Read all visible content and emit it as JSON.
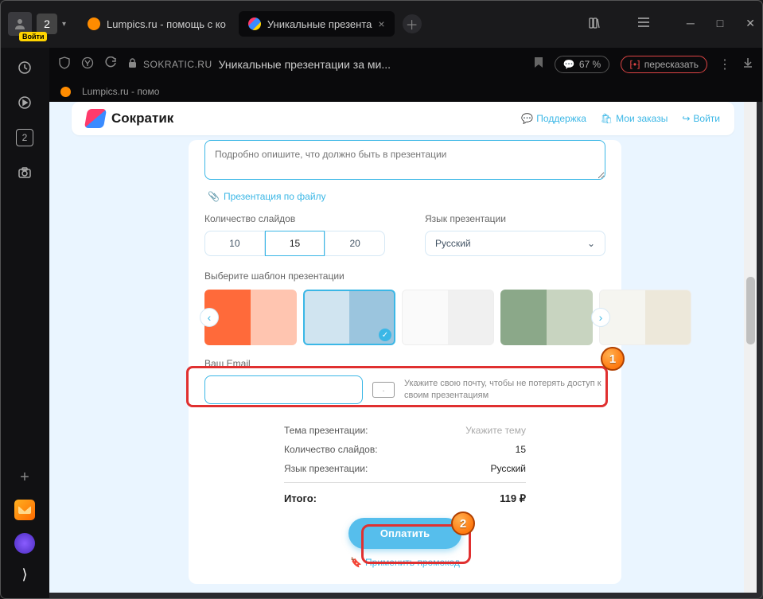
{
  "browser": {
    "login_badge": "Войти",
    "tab_count": "2",
    "tabs": [
      {
        "label": "Lumpics.ru - помощь с ко"
      },
      {
        "label": "Уникальные презента"
      }
    ],
    "domain": "sokratic.ru",
    "page_title": "Уникальные презентации за ми...",
    "zoom": "67 %",
    "summarize": "пересказать",
    "bookmark_label": "Lumpics.ru - помо",
    "sidebar_count": "2"
  },
  "site": {
    "brand": "Сократик",
    "links": {
      "support": "Поддержка",
      "orders": "Мои заказы",
      "login": "Войти"
    }
  },
  "form": {
    "desc_placeholder": "Подробно опишите, что должно быть в презентации",
    "file_link": "Презентация по файлу",
    "slides_label": "Количество слайдов",
    "slide_options": [
      "10",
      "15",
      "20"
    ],
    "lang_label": "Язык презентации",
    "lang_value": "Русский",
    "template_label": "Выберите шаблон презентации",
    "email_label": "Ваш Email",
    "email_hint": "Укажите свою почту, чтобы не потерять доступ к своим презентациям"
  },
  "summary": {
    "theme_label": "Тема презентации:",
    "theme_value": "Укажите тему",
    "slides_label": "Количество слайдов:",
    "slides_value": "15",
    "lang_label": "Язык презентации:",
    "lang_value": "Русский",
    "total_label": "Итого:",
    "total_value": "119 ₽",
    "pay_button": "Оплатить",
    "promo_link": "Применить промокод"
  },
  "callouts": {
    "one": "1",
    "two": "2"
  }
}
